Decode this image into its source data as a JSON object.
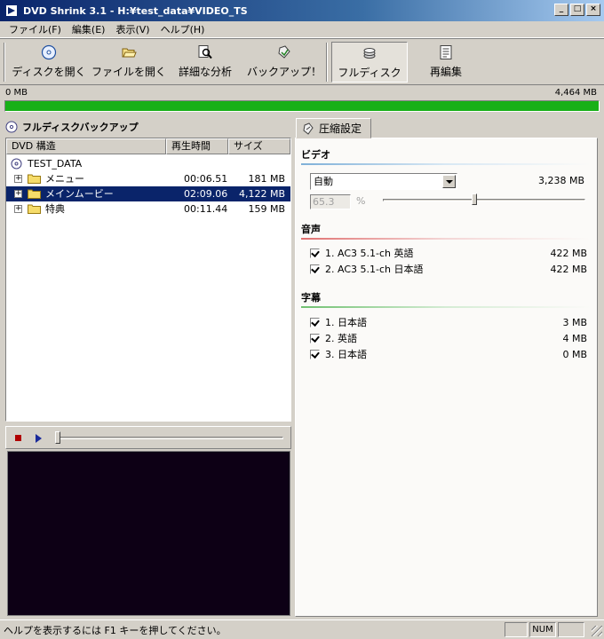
{
  "window": {
    "title": "DVD Shrink 3.1 - H:¥test_data¥VIDEO_TS",
    "controls": [
      "_",
      "□",
      "×"
    ]
  },
  "menu": [
    {
      "label": "ファイル(F)"
    },
    {
      "label": "編集(E)"
    },
    {
      "label": "表示(V)"
    },
    {
      "label": "ヘルプ(H)"
    }
  ],
  "toolbar": {
    "open_disc": "ディスクを開く",
    "open_files": "ファイルを開く",
    "analyze": "詳細な分析",
    "backup": "バックアップ！",
    "full_disc": "フルディスク",
    "reauthor": "再編集"
  },
  "size_bar": {
    "min_label": "0 MB",
    "max_label": "4,464 MB",
    "fill_fraction": 1.0,
    "color": "#18b018"
  },
  "left_panel": {
    "title": "フルディスクバックアップ",
    "columns": {
      "structure": "DVD 構造",
      "duration": "再生時間",
      "size": "サイズ"
    },
    "root": "TEST_DATA",
    "rows": [
      {
        "name": "メニュー",
        "duration": "00:06.51",
        "size": "181 MB",
        "selected": false
      },
      {
        "name": "メインムービー",
        "duration": "02:09.06",
        "size": "4,122 MB",
        "selected": true
      },
      {
        "name": "特典",
        "duration": "00:11.44",
        "size": "159 MB",
        "selected": false
      }
    ]
  },
  "player": {
    "position_fraction": 0.0
  },
  "right_panel": {
    "tab_label": "圧縮設定",
    "video": {
      "heading": "ビデオ",
      "mode": "自動",
      "size": "3,238 MB",
      "percent_value": "65.3",
      "percent_sign": "%",
      "slider_fraction": 0.45
    },
    "audio": {
      "heading": "音声",
      "tracks": [
        {
          "label": "1. AC3 5.1-ch 英語",
          "size": "422 MB",
          "checked": true
        },
        {
          "label": "2. AC3 5.1-ch 日本語",
          "size": "422 MB",
          "checked": true
        }
      ]
    },
    "subtitles": {
      "heading": "字幕",
      "tracks": [
        {
          "label": "1. 日本語",
          "size": "3 MB",
          "checked": true
        },
        {
          "label": "2. 英語",
          "size": "4 MB",
          "checked": true
        },
        {
          "label": "3. 日本語",
          "size": "0 MB",
          "checked": true
        }
      ]
    }
  },
  "status": {
    "text": "ヘルプを表示するには F1 キーを押してください。",
    "num": "NUM"
  },
  "colors": {
    "selection": "#0a246a",
    "video_line": "#7fb0d8",
    "audio_line": "#e07070",
    "subtitle_line": "#70c070"
  }
}
